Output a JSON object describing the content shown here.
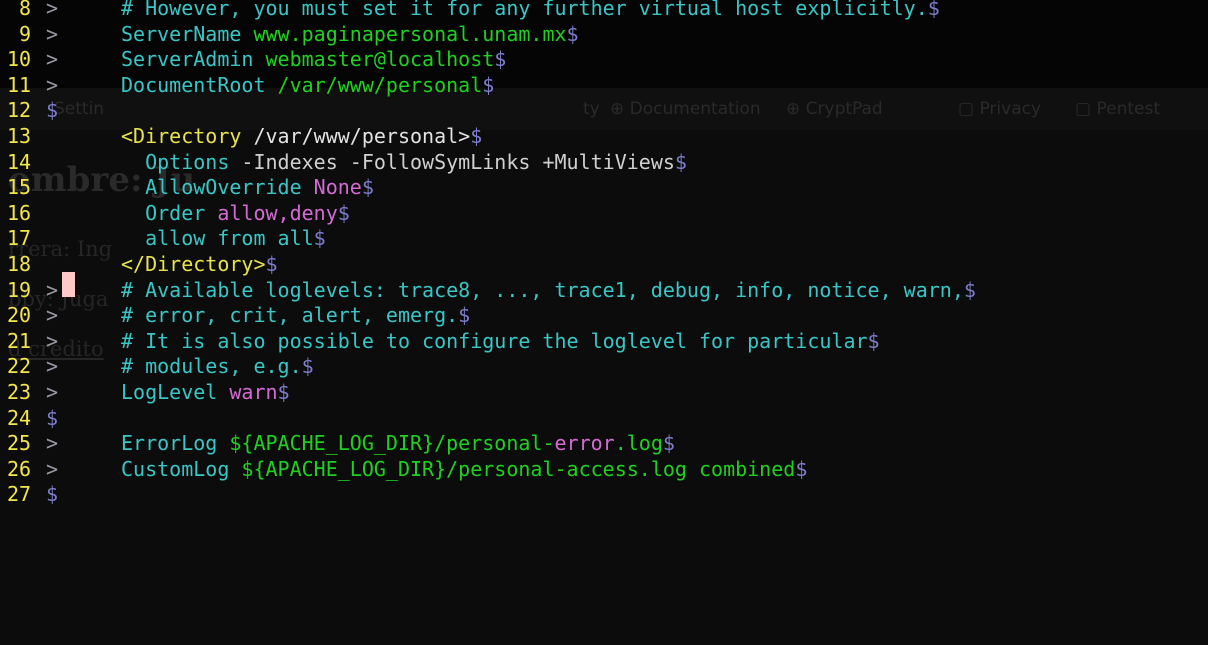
{
  "background_browser": {
    "bookmarks": [
      {
        "label": "Settin"
      },
      {
        "label": "ty"
      },
      {
        "label": "⊕ Documentation"
      },
      {
        "label": "⊕ CryptPad"
      },
      {
        "label": "▢ Privacy"
      },
      {
        "label": "▢ Pentest"
      }
    ],
    "page": {
      "heading": "ombre: Ju",
      "line1": "rrera: Ing",
      "line2": "bby: Juga",
      "line3": "d credito"
    }
  },
  "terminal": {
    "eol_marker": "$",
    "lines": [
      {
        "num": "8",
        "marker": ">",
        "parts": [
          {
            "t": "# However, you must set it for any further virtual host explicitly.",
            "c": "comment"
          }
        ]
      },
      {
        "num": "9",
        "marker": ">",
        "parts": [
          {
            "t": "ServerName ",
            "c": "key"
          },
          {
            "t": "www.paginapersonal.unam.mx",
            "c": "env"
          }
        ]
      },
      {
        "num": "10",
        "marker": ">",
        "parts": [
          {
            "t": "ServerAdmin ",
            "c": "key"
          },
          {
            "t": "webmaster@localhost",
            "c": "env"
          }
        ]
      },
      {
        "num": "11",
        "marker": ">",
        "parts": [
          {
            "t": "DocumentRoot ",
            "c": "key"
          },
          {
            "t": "/var/www/personal",
            "c": "env"
          }
        ]
      },
      {
        "num": "12",
        "marker": "$",
        "parts": []
      },
      {
        "num": "13",
        "marker": "",
        "parts": [
          {
            "t": "<Directory",
            "c": "tag"
          },
          {
            "t": " /var/www/personal>",
            "c": "tag2"
          }
        ]
      },
      {
        "num": "14",
        "marker": "",
        "parts": [
          {
            "t": "  Options ",
            "c": "opt"
          },
          {
            "t": "-Indexes -FollowSymLinks +MultiViews",
            "c": "opt2"
          }
        ]
      },
      {
        "num": "15",
        "marker": "",
        "parts": [
          {
            "t": "  AllowOverride ",
            "c": "opt"
          },
          {
            "t": "None",
            "c": "val"
          }
        ]
      },
      {
        "num": "16",
        "marker": "",
        "parts": [
          {
            "t": "  Order ",
            "c": "opt"
          },
          {
            "t": "allow,deny",
            "c": "val"
          }
        ]
      },
      {
        "num": "17",
        "marker": "",
        "parts": [
          {
            "t": "  allow from all",
            "c": "opt"
          }
        ]
      },
      {
        "num": "18",
        "marker": "",
        "parts": [
          {
            "t": "</Directory>",
            "c": "tag"
          }
        ]
      },
      {
        "num": "19",
        "marker": ">",
        "parts": [
          {
            "t": "# Available loglevels: trace8, ..., trace1, debug, info, notice, warn,",
            "c": "comment"
          }
        ]
      },
      {
        "num": "20",
        "marker": ">",
        "parts": [
          {
            "t": "# error, crit, alert, emerg.",
            "c": "comment"
          }
        ]
      },
      {
        "num": "21",
        "marker": ">",
        "parts": [
          {
            "t": "# It is also possible to configure the loglevel for particular",
            "c": "comment"
          }
        ]
      },
      {
        "num": "22",
        "marker": ">",
        "parts": [
          {
            "t": "# modules, e.g.",
            "c": "comment"
          }
        ]
      },
      {
        "num": "23",
        "marker": ">",
        "parts": [
          {
            "t": "LogLevel ",
            "c": "key"
          },
          {
            "t": "warn",
            "c": "val"
          }
        ]
      },
      {
        "num": "24",
        "marker": "$",
        "parts": []
      },
      {
        "num": "25",
        "marker": ">",
        "parts": [
          {
            "t": "ErrorLog ",
            "c": "key"
          },
          {
            "t": "${APACHE_LOG_DIR}/personal-",
            "c": "env"
          },
          {
            "t": "error",
            "c": "val"
          },
          {
            "t": ".log",
            "c": "env"
          }
        ]
      },
      {
        "num": "26",
        "marker": ">",
        "parts": [
          {
            "t": "CustomLog ",
            "c": "key"
          },
          {
            "t": "${APACHE_LOG_DIR}/personal-access.log combined",
            "c": "env"
          }
        ]
      },
      {
        "num": "27",
        "marker": "$",
        "parts": []
      }
    ]
  },
  "colors": {
    "line_number": "#f2e64a",
    "comment": "#3ac6c6",
    "env_value": "#20d020",
    "value": "#d36bd3",
    "eol_marker": "#7d7dcc",
    "cursor": "#ffc8c8",
    "background": "#050505"
  }
}
